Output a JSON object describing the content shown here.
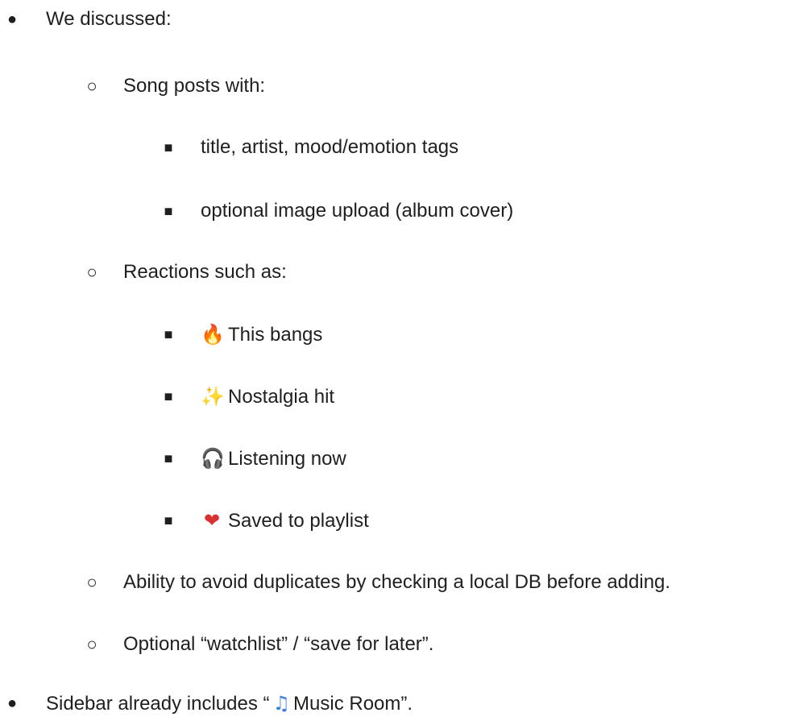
{
  "bullets": {
    "level1": "●",
    "level2": "○",
    "level3": "■"
  },
  "items": {
    "we_discussed": "We discussed:",
    "song_posts": "Song posts with:",
    "title_artist": "title, artist, mood/emotion tags",
    "image_upload": "optional image upload (album cover)",
    "reactions": "Reactions such as:",
    "this_bangs": "This bangs",
    "nostalgia": "Nostalgia hit",
    "listening": "Listening now",
    "saved": "Saved to playlist",
    "avoid_duplicates": "Ability to avoid duplicates by checking a local DB before adding.",
    "watchlist": "Optional “watchlist” / “save for later”.",
    "sidebar_prefix": "Sidebar already includes “",
    "sidebar_name": "Music Room",
    "sidebar_suffix": "”."
  },
  "emoji": {
    "fire": "🔥",
    "sparkles": "✨",
    "headphones": "🎧",
    "heart": "❤",
    "note": "♫"
  },
  "colors": {
    "text": "#1f1f1f",
    "fire": "#f28c1c",
    "sparkles": "#f5c518",
    "heart": "#d93030",
    "note": "#3b7fe0"
  }
}
